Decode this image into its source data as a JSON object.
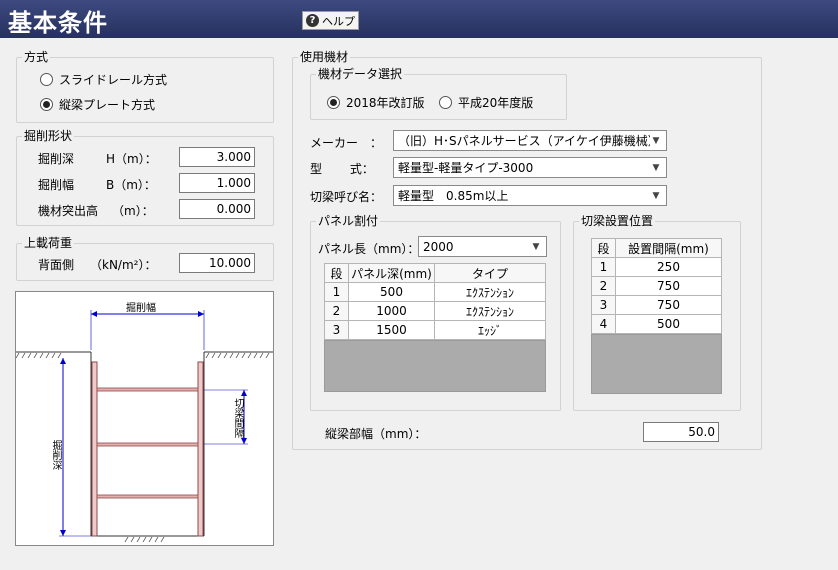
{
  "header": {
    "title": "基本条件",
    "help_label": "ヘルプ",
    "help_icon": "question-icon"
  },
  "method": {
    "legend": "方式",
    "options": [
      {
        "label": "スライドレール方式",
        "selected": false
      },
      {
        "label": "縦梁プレート方式",
        "selected": true
      }
    ]
  },
  "excavation": {
    "legend": "掘削形状",
    "fields": [
      {
        "label": "掘削深",
        "symbol": "H（m）：",
        "value": "3.000"
      },
      {
        "label": "掘削幅",
        "symbol": "B（m）：",
        "value": "1.000"
      },
      {
        "label": "機材突出高",
        "symbol": "（m）：",
        "value": "0.000"
      }
    ]
  },
  "surcharge": {
    "legend": "上載荷重",
    "label": "背面側",
    "unit": "（kN/m²）：",
    "value": "10.000"
  },
  "diagram": {
    "width_label": "掘削幅",
    "depth_label": "掘削深",
    "strut_spacing_label": "切梁間隔"
  },
  "equipment": {
    "legend": "使用機材",
    "data_selection": {
      "legend": "機材データ選択",
      "options": [
        {
          "label": "2018年改訂版",
          "selected": true
        },
        {
          "label": "平成20年度版",
          "selected": false
        }
      ]
    },
    "maker": {
      "label": "メーカー　：",
      "value": "（旧）H･Sパネルサービス（アイケイ伊藤機械）"
    },
    "model": {
      "label": "型　　 式：",
      "value": "軽量型-軽量タイプ-3000"
    },
    "strut_name": {
      "label": "切梁呼び名：",
      "value": "軽量型　0.85m以上"
    },
    "panel_allocation": {
      "legend": "パネル割付",
      "length_label": "パネル長（mm）：",
      "length_value": "2000",
      "columns": [
        "段",
        "パネル深(mm)",
        "タイプ"
      ],
      "rows": [
        [
          "1",
          "500",
          "ｴｸｽﾃﾝｼｮﾝ"
        ],
        [
          "2",
          "1000",
          "ｴｸｽﾃﾝｼｮﾝ"
        ],
        [
          "3",
          "1500",
          "ｴｯｼﾞ"
        ]
      ]
    },
    "strut_position": {
      "legend": "切梁設置位置",
      "columns": [
        "段",
        "設置間隔(mm)"
      ],
      "rows": [
        [
          "1",
          "250"
        ],
        [
          "2",
          "750"
        ],
        [
          "3",
          "750"
        ],
        [
          "4",
          "500"
        ]
      ]
    },
    "beam_width": {
      "label": "縦梁部幅（mm）：",
      "value": "50.0"
    }
  }
}
